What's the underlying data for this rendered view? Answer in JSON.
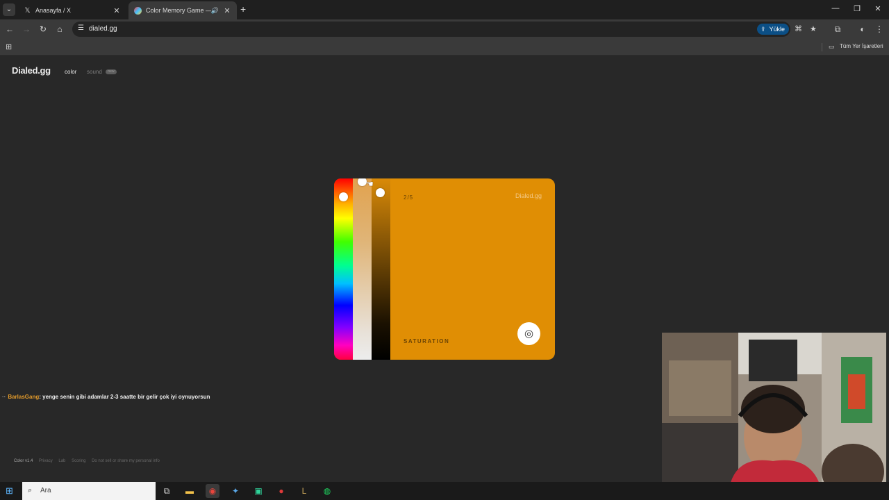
{
  "browser": {
    "tabs": [
      {
        "title": "Anasayfa / X",
        "icon": "x-logo-icon",
        "active": false
      },
      {
        "title": "Color Memory Game — Ho",
        "icon": "color-wheel-icon",
        "active": true,
        "audio": true
      }
    ],
    "url": "dialed.gg",
    "upload_button": "Yükle",
    "bookmarks_label": "Tüm Yer İşaretleri"
  },
  "site": {
    "logo": "Dialed.gg",
    "nav": {
      "color": "color",
      "sound": "sound",
      "sound_badge": "new"
    }
  },
  "game": {
    "progress": "2/5",
    "brand": "Dialed.gg",
    "phase": "SATURATION",
    "current_color": "#e08e04",
    "submit_icon": "target-icon"
  },
  "chat": {
    "prefix": "··",
    "user": "BarlasGang",
    "message": ": yenge senin gibi adamlar 2-3 saatte bir gelir çok iyi oynuyorsun"
  },
  "footer": {
    "version": "Color v1.4",
    "links": [
      "Privacy",
      "Lab",
      "Scoring",
      "Do not sell or share my personal info"
    ]
  },
  "taskbar": {
    "search_placeholder": "Ara",
    "apps": [
      "task-view-icon",
      "file-explorer-icon",
      "chrome-icon",
      "app-icon",
      "discord-icon",
      "red-app-icon",
      "league-icon",
      "spotify-icon"
    ]
  }
}
